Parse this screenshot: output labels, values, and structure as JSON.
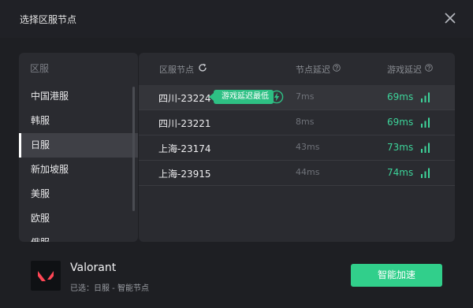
{
  "window": {
    "title": "选择区服节点"
  },
  "regions": {
    "header": "区服",
    "items": [
      {
        "label": "中国港服",
        "active": false
      },
      {
        "label": "韩服",
        "active": false
      },
      {
        "label": "日服",
        "active": true
      },
      {
        "label": "新加坡服",
        "active": false
      },
      {
        "label": "美服",
        "active": false
      },
      {
        "label": "欧服",
        "active": false
      },
      {
        "label": "俄服",
        "active": false
      }
    ]
  },
  "nodes": {
    "columns": {
      "node": "区服节点",
      "node_delay": "节点延迟",
      "game_delay": "游戏延迟"
    },
    "badge": "游戏延迟最低",
    "rows": [
      {
        "name": "四川-23224",
        "node_delay": "7ms",
        "game_delay": "69ms"
      },
      {
        "name": "四川-23221",
        "node_delay": "8ms",
        "game_delay": "69ms"
      },
      {
        "name": "上海-23174",
        "node_delay": "43ms",
        "game_delay": "73ms"
      },
      {
        "name": "上海-23915",
        "node_delay": "44ms",
        "game_delay": "74ms"
      }
    ]
  },
  "footer": {
    "game_name": "Valorant",
    "selected_info": "已选：日服 - 智能节点",
    "accelerate_label": "智能加速"
  },
  "colors": {
    "accent_green": "#31cf8b",
    "delay_green": "#3dd49a",
    "logo_red": "#ff4655",
    "background": "#1e1f23"
  }
}
